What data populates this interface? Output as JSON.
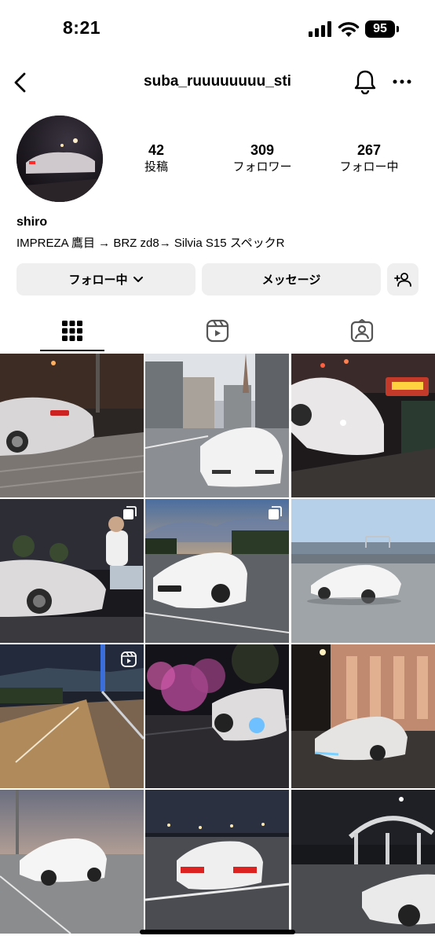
{
  "status_bar": {
    "time": "8:21",
    "battery": "95"
  },
  "header": {
    "username": "suba_ruuuuuuuu_sti"
  },
  "profile": {
    "stats": [
      {
        "value": "42",
        "label": "投稿"
      },
      {
        "value": "309",
        "label": "フォロワー"
      },
      {
        "value": "267",
        "label": "フォロー中"
      }
    ],
    "name": "shiro",
    "bio": "IMPREZA 鷹目 → BRZ zd8→ Silvia S15 スペックR"
  },
  "actions": {
    "follow_label": "フォロー中",
    "message_label": "メッセージ"
  },
  "tabs": [
    {
      "icon": "grid-icon",
      "selected": true
    },
    {
      "icon": "reels-icon",
      "selected": false
    },
    {
      "icon": "tagged-icon",
      "selected": false
    }
  ],
  "posts": [
    {
      "scene": "night street with white Silvia S15",
      "badge": ""
    },
    {
      "scene": "white Silvia S15 in city street, daytime",
      "badge": ""
    },
    {
      "scene": "white Silvia S15 at night with neon signs",
      "badge": ""
    },
    {
      "scene": "person sitting on white Silvia at night",
      "badge": "multi-image-icon"
    },
    {
      "scene": "white BRZ in parking lot at sunset",
      "badge": "multi-image-icon"
    },
    {
      "scene": "white BRZ by bay bridge daytime",
      "badge": ""
    },
    {
      "scene": "night road with bridge",
      "badge": "reel-icon"
    },
    {
      "scene": "white BRZ under pink cherry blossoms at night",
      "badge": ""
    },
    {
      "scene": "white BRZ in front of lit building at night",
      "badge": ""
    },
    {
      "scene": "white BRZ at dusk parking lot",
      "badge": ""
    },
    {
      "scene": "white BRZ rear at night parking lot",
      "badge": ""
    },
    {
      "scene": "white BRZ under arched canopy at night",
      "badge": ""
    }
  ],
  "colors": {
    "button_bg": "#efefef",
    "text": "#000000",
    "background": "#ffffff"
  }
}
